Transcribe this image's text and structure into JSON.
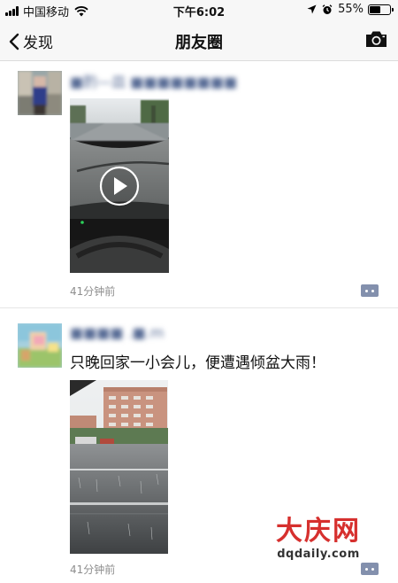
{
  "status_bar": {
    "carrier": "中国移动",
    "time": "下午6:02",
    "battery": "55%",
    "battery_level": 0.55
  },
  "nav": {
    "back_label": "发现",
    "title": "朋友圈",
    "icons": [
      "chevron-left-icon",
      "camera-icon"
    ]
  },
  "feed": {
    "posts": [
      {
        "username": "■酌—皿 ■■■■■■■■",
        "text": "",
        "media": "video",
        "time": "41分钟前"
      },
      {
        "username": "■■■■ .■.m",
        "text": "只晚回家一小会儿，便遭遇倾盆大雨！",
        "media": "image",
        "time": "41分钟前"
      }
    ]
  },
  "watermark": {
    "logo": "大庆网",
    "url": "dqdaily.com"
  },
  "colors": {
    "link": "#576b95",
    "bar_bg": "#f7f7f7",
    "timestamp": "#8e8e8e",
    "watermark_red": "#d6302e"
  }
}
